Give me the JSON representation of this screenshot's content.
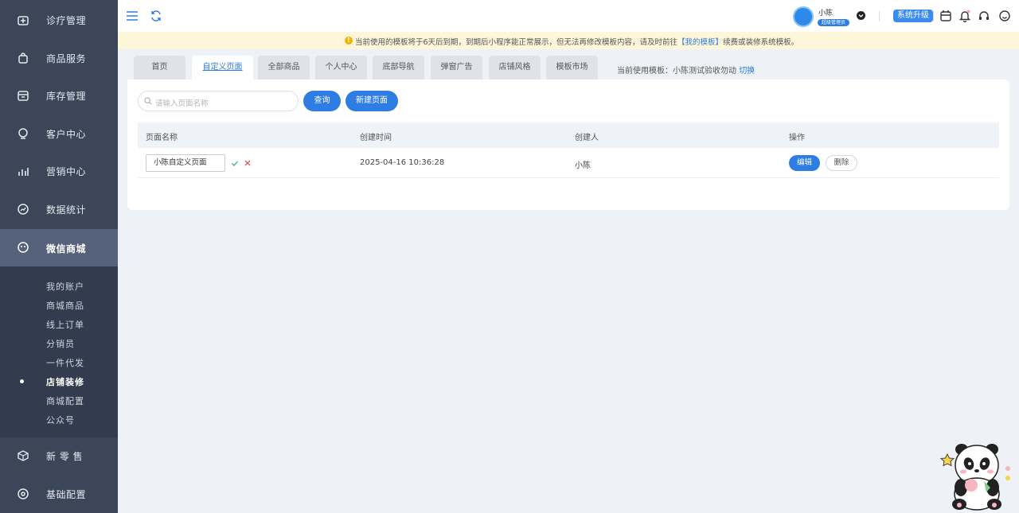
{
  "sidebar": {
    "items": [
      {
        "label": "诊疗管理",
        "icon": "clinic-icon"
      },
      {
        "label": "商品服务",
        "icon": "shopping-bag-icon"
      },
      {
        "label": "库存管理",
        "icon": "inventory-icon"
      },
      {
        "label": "客户中心",
        "icon": "customer-icon"
      },
      {
        "label": "营销中心",
        "icon": "marketing-chart-icon"
      },
      {
        "label": "数据统计",
        "icon": "statistics-icon"
      },
      {
        "label": "微信商城",
        "icon": "wechat-mall-icon"
      },
      {
        "label": "新 零 售",
        "icon": "new-retail-icon"
      },
      {
        "label": "基础配置",
        "icon": "settings-icon"
      }
    ],
    "subitems": [
      "我的账户",
      "商城商品",
      "线上订单",
      "分销员",
      "一件代发",
      "店铺装修",
      "商城配置",
      "公众号"
    ],
    "active_subitem": "店铺装修"
  },
  "header": {
    "user_name": "小陈",
    "user_role": "超级管理员",
    "upgrade_label": "系统升级",
    "icons": [
      "menu-icon",
      "refresh-icon",
      "calendar-icon",
      "bell-icon",
      "headset-icon",
      "chat-icon"
    ]
  },
  "notice": {
    "text_before": "当前使用的模板将于6天后到期，到期后小程序能正常展示，但无法再修改模板内容，请及时前往",
    "link": "【我的模板】",
    "text_after": "续费或装修系统模板。"
  },
  "tabs": [
    "首页",
    "自定义页面",
    "全部商品",
    "个人中心",
    "底部导航",
    "弹窗广告",
    "店铺风格",
    "模板市场"
  ],
  "active_tab": "自定义页面",
  "template_info": {
    "label": "当前使用模板：小陈测试验收勿动",
    "switch_label": "切换"
  },
  "search": {
    "placeholder": "请输入页面名称",
    "query_label": "查询",
    "new_page_label": "新建页面"
  },
  "table": {
    "columns": [
      "页面名称",
      "创建时间",
      "创建人",
      "操作"
    ],
    "rows": [
      {
        "name": "小陈自定义页面",
        "created": "2025-04-16 10:36:28",
        "creator": "小陈",
        "edit_label": "编辑",
        "delete_label": "删除"
      }
    ]
  },
  "colors": {
    "sidebar_bg": "#3b4659",
    "accent": "#2d7de2",
    "notice_bg": "#fdf6d9"
  }
}
